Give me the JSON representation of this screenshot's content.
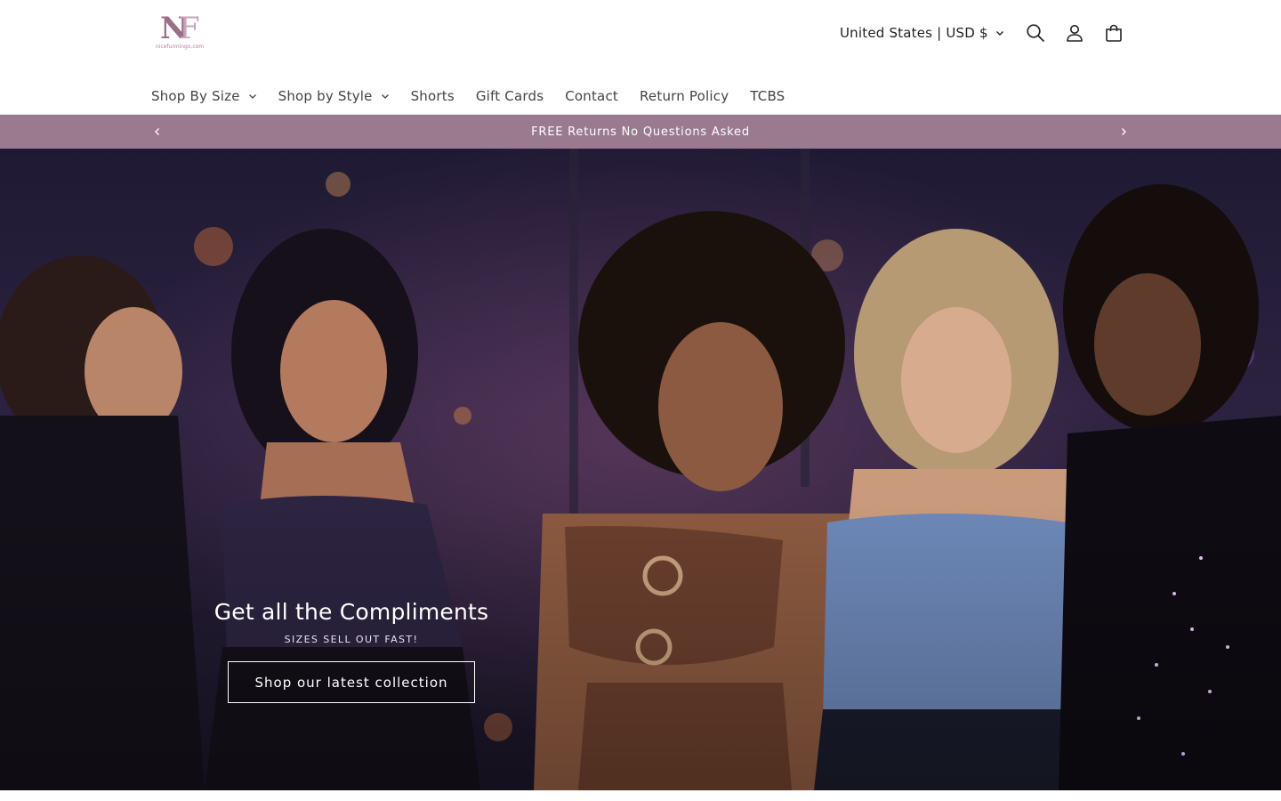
{
  "header": {
    "logo": {
      "mark": "NF",
      "subtext": "nicefurmingo.com"
    },
    "locale_label": "United States | USD $",
    "icons": {
      "search": "search-icon",
      "account": "account-icon",
      "cart": "cart-icon"
    },
    "nav": [
      {
        "label": "Shop By Size",
        "has_dropdown": true
      },
      {
        "label": "Shop by Style",
        "has_dropdown": true
      },
      {
        "label": "Shorts",
        "has_dropdown": false
      },
      {
        "label": "Gift Cards",
        "has_dropdown": false
      },
      {
        "label": "Contact",
        "has_dropdown": false
      },
      {
        "label": "Return Policy",
        "has_dropdown": false
      },
      {
        "label": "TCBS",
        "has_dropdown": false
      }
    ]
  },
  "announcement": {
    "text": "FREE Returns No Questions Asked",
    "background": "#9a7a8f"
  },
  "hero": {
    "title": "Get all the Compliments",
    "subtitle": "SIZES SELL OUT FAST!",
    "button_label": "Shop our latest collection"
  },
  "colors": {
    "accent": "#9a7a8f",
    "logo": "#9c6f88",
    "text": "#333333"
  }
}
